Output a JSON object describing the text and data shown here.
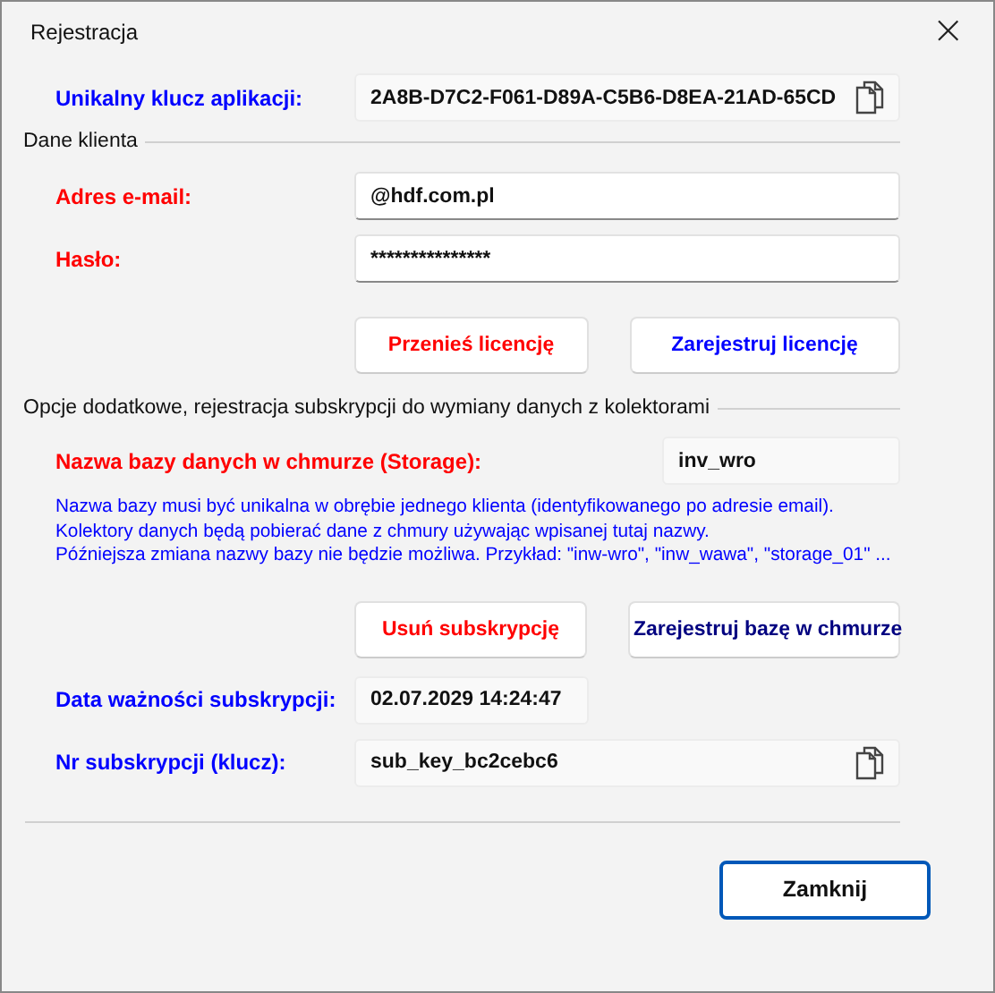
{
  "window": {
    "title": "Rejestracja",
    "close": "×"
  },
  "app_key": {
    "label": "Unikalny klucz aplikacji:",
    "color": "#0000ff",
    "value": "2A8B-D7C2-F061-D89A-C5B6-D8EA-21AD-65CD"
  },
  "client_section": {
    "title": "Dane klienta",
    "fields": [
      {
        "label": "Adres e-mail:",
        "color": "#ff0000",
        "value": "@hdf.com.pl"
      },
      {
        "label": "Hasło:",
        "color": "#ff0000",
        "value": "***************"
      }
    ],
    "buttons": [
      {
        "label": "Przenieś licencję",
        "color": "#ff0000"
      },
      {
        "label": "Zarejestruj licencję",
        "color": "#0000ff"
      }
    ]
  },
  "options_section": {
    "title": "Opcje dodatkowe, rejestracja subskrypcji do wymiany danych z kolektorami",
    "storage": {
      "label": "Nazwa bazy danych w chmurze (Storage):",
      "color": "#ff0000",
      "value": "inv_wro"
    },
    "info": [
      "Nazwa bazy musi być unikalna w obrębie jednego klienta (identyfikowanego po adresie email). Kolektory danych będą pobierać dane z chmury używając wpisanej tutaj nazwy.",
      "Późniejsza zmiana nazwy bazy nie będzie możliwa. Przykład: \"inw-wro\", \"inw_wawa\", \"storage_01\" ..."
    ],
    "buttons": [
      {
        "label": "Usuń subskrypcję",
        "color": "#ff0000"
      },
      {
        "label": "Zarejestruj bazę w chmurze",
        "color": "#000080"
      }
    ],
    "expiry": {
      "label": "Data ważności subskrypcji:",
      "color": "#0000ff",
      "value": "02.07.2029 14:24:47"
    },
    "sub_key": {
      "label": "Nr subskrypcji (klucz):",
      "color": "#0000ff",
      "value": "sub_key_bc2cebc6"
    }
  },
  "footer": {
    "button": "Zamknij"
  }
}
